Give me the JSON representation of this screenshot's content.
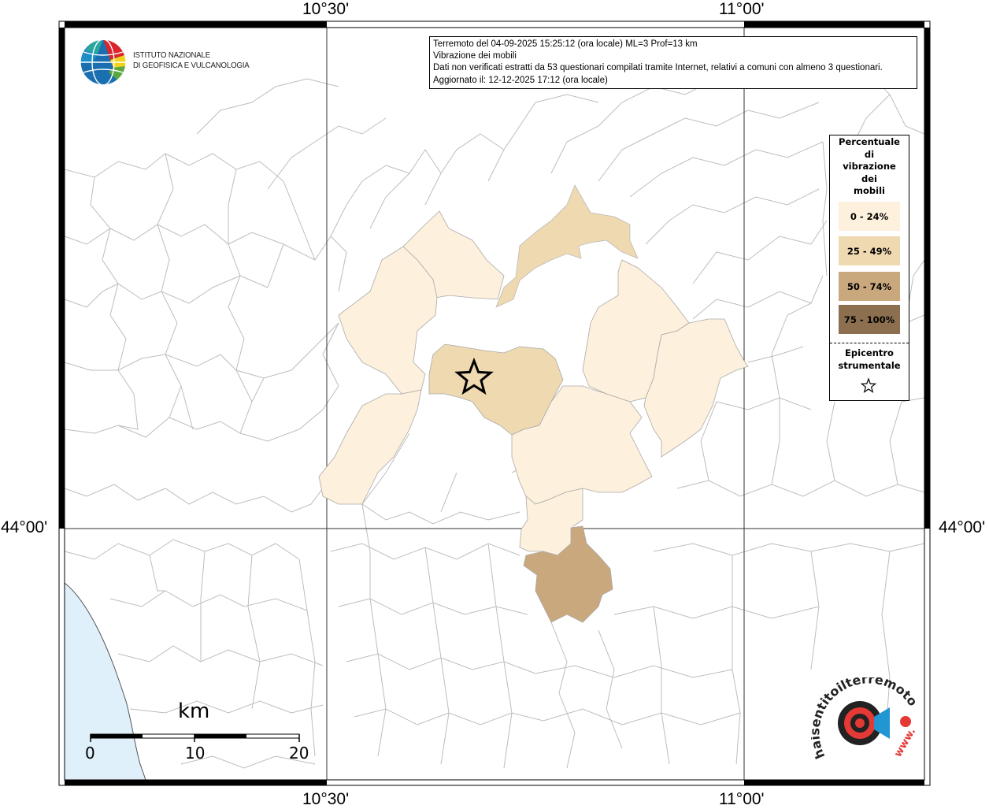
{
  "coords": {
    "top_left": "10°30'",
    "top_right": "11°00'",
    "bottom_left": "10°30'",
    "bottom_right": "11°00'",
    "left_mid": "44°00'",
    "right_mid": "44°00'"
  },
  "infobox": {
    "line1": "Terremoto del 04-09-2025 15:25:12 (ora locale) ML=3 Prof=13 km",
    "line2": "Vibrazione dei mobili",
    "line3": "Dati non verificati estratti da 53 questionari compilati tramite Internet, relativi a comuni con almeno 3 questionari.",
    "line4": "Aggiornato il: 12-12-2025 17:12 (ora locale)"
  },
  "legend": {
    "title_lines": [
      "Percentuale",
      "di",
      "vibrazione",
      "dei",
      "mobili"
    ],
    "items": [
      {
        "label": "0 - 24%",
        "color": "#fdf0dc"
      },
      {
        "label": "25 - 49%",
        "color": "#eed9b0"
      },
      {
        "label": "50 - 74%",
        "color": "#c9a87d"
      },
      {
        "label": "75 - 100%",
        "color": "#8b6f4e"
      }
    ],
    "epicenter_line1": "Epicentro",
    "epicenter_line2": "strumentale"
  },
  "logo": {
    "line1": "ISTITUTO NAZIONALE",
    "line2": "DI GEOFISICA E VULCANOLOGIA"
  },
  "scale": {
    "unit": "km",
    "labels": [
      "0",
      "10",
      "20"
    ]
  },
  "watermark": {
    "text": "haisentitoilterremoto.it",
    "www": "www."
  },
  "colors": {
    "sea": "#dff0fb",
    "border": "#bbbbbb"
  }
}
